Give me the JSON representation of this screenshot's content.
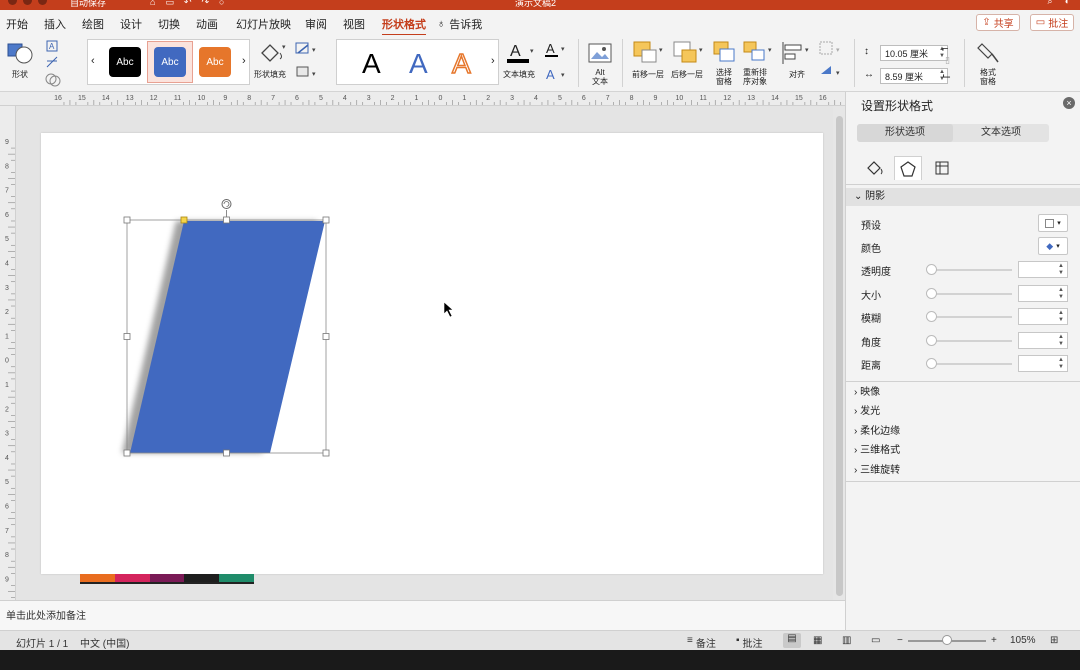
{
  "window": {
    "title": "演示文稿2",
    "autosave_label": "自动保存"
  },
  "tabs": [
    {
      "label": "开始"
    },
    {
      "label": "插入"
    },
    {
      "label": "绘图"
    },
    {
      "label": "设计"
    },
    {
      "label": "切换"
    },
    {
      "label": "动画"
    },
    {
      "label": "幻灯片放映"
    },
    {
      "label": "审阅"
    },
    {
      "label": "视图"
    },
    {
      "label": "形状格式",
      "active": true
    },
    {
      "label": "告诉我"
    }
  ],
  "header_buttons": {
    "share": "共享",
    "comment": "批注"
  },
  "ribbon": {
    "shape_label": "形状",
    "style_gallery": [
      "Abc",
      "Abc",
      "Abc"
    ],
    "style_colors": [
      "#000000",
      "#4169c0",
      "#e6762b"
    ],
    "shape_fill_label": "形状填充",
    "wordart_letters": [
      "A",
      "A",
      "A"
    ],
    "text_fill_label": "文本填充",
    "alt_text_label": "Alt\n文本",
    "bring_forward": "前移一层",
    "send_backward": "后移一层",
    "selection_pane": "选择\n窗格",
    "reorder": "重新排\n序对象",
    "align": "对齐",
    "height_value": "10.05 厘米",
    "width_value": "8.59 厘米",
    "format_pane": "格式\n窗格"
  },
  "ruler": {
    "h_ticks": [
      "16",
      "15",
      "14",
      "13",
      "12",
      "11",
      "10",
      "9",
      "8",
      "7",
      "6",
      "5",
      "4",
      "3",
      "2",
      "1",
      "0",
      "1",
      "2",
      "3",
      "4",
      "5",
      "6",
      "7",
      "8",
      "9",
      "10",
      "11",
      "12",
      "13",
      "14",
      "15",
      "16"
    ],
    "v_ticks": [
      "9",
      "8",
      "7",
      "6",
      "5",
      "4",
      "3",
      "2",
      "1",
      "0",
      "1",
      "2",
      "3",
      "4",
      "5",
      "6",
      "7",
      "8",
      "9"
    ]
  },
  "slide": {
    "shape_color": "#4169c0",
    "thumb_colors": [
      "#e96d1f",
      "#d4245d",
      "#7a1a56",
      "#1e1e1e",
      "#1f8c6a"
    ]
  },
  "notes_placeholder": "单击此处添加备注",
  "panel": {
    "title": "设置形状格式",
    "seg_shape": "形状选项",
    "seg_text": "文本选项",
    "section_shadow": "阴影",
    "shadow_rows": [
      {
        "label": "预设"
      },
      {
        "label": "颜色"
      },
      {
        "label": "透明度"
      },
      {
        "label": "大小"
      },
      {
        "label": "模糊"
      },
      {
        "label": "角度"
      },
      {
        "label": "距离"
      }
    ],
    "collapsed_sections": [
      "映像",
      "发光",
      "柔化边缘",
      "三维格式",
      "三维旋转"
    ]
  },
  "status": {
    "slide_info": "幻灯片 1 / 1",
    "language": "中文 (中国)",
    "notes": "备注",
    "comments": "批注",
    "zoom": "105%"
  }
}
